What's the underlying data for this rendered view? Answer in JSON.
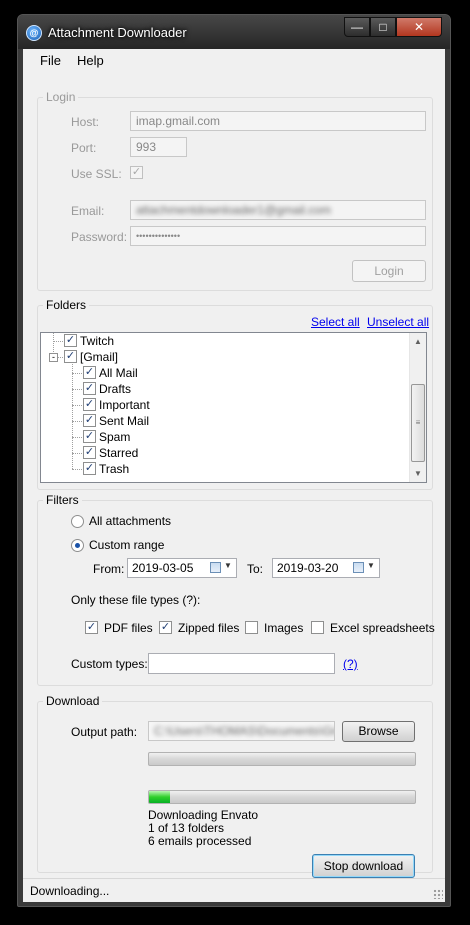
{
  "window": {
    "title": "Attachment Downloader",
    "close_glyph": "✕",
    "max_glyph": "□",
    "min_glyph": "—"
  },
  "menu": {
    "file": "File",
    "help": "Help"
  },
  "login": {
    "title": "Login",
    "host_label": "Host:",
    "host_value": "imap.gmail.com",
    "port_label": "Port:",
    "port_value": "993",
    "ssl_label": "Use SSL:",
    "email_label": "Email:",
    "email_value": "attachmentdownloader1@gmail.com",
    "password_label": "Password:",
    "password_value": "••••••••••••••",
    "login_button": "Login"
  },
  "folders": {
    "title": "Folders",
    "select_all": "Select all",
    "unselect_all": "Unselect all",
    "items": [
      {
        "label": "Twitch",
        "level": 0
      },
      {
        "label": "[Gmail]",
        "level": 0
      },
      {
        "label": "All Mail",
        "level": 1
      },
      {
        "label": "Drafts",
        "level": 1
      },
      {
        "label": "Important",
        "level": 1
      },
      {
        "label": "Sent Mail",
        "level": 1
      },
      {
        "label": "Spam",
        "level": 1
      },
      {
        "label": "Starred",
        "level": 1
      },
      {
        "label": "Trash",
        "level": 1
      }
    ]
  },
  "filters": {
    "title": "Filters",
    "all_attachments": "All attachments",
    "custom_range": "Custom range",
    "from_label": "From:",
    "from_value": "2019-03-05",
    "to_label": "To:",
    "to_value": "2019-03-20",
    "file_types_label": "Only these file types (?):",
    "pdf": "PDF files",
    "zipped": "Zipped files",
    "images": "Images",
    "excel": "Excel spreadsheets",
    "custom_types_label": "Custom types:",
    "custom_types_value": "",
    "help_link": "(?)"
  },
  "download": {
    "title": "Download",
    "output_label": "Output path:",
    "output_value": "C:\\Users\\THOMAS\\Documents\\Gmail",
    "browse_button": "Browse",
    "folder_progress": 0,
    "item_progress": 0.08,
    "status_line1": "Downloading Envato",
    "status_line2": "1 of 13 folders",
    "status_line3": "6 emails processed",
    "stop_button": "Stop download"
  },
  "status_bar": {
    "text": "Downloading..."
  },
  "colors": {
    "link": "#0000ee",
    "progress": "#06b025",
    "titlebar": "#2e2e2e"
  }
}
